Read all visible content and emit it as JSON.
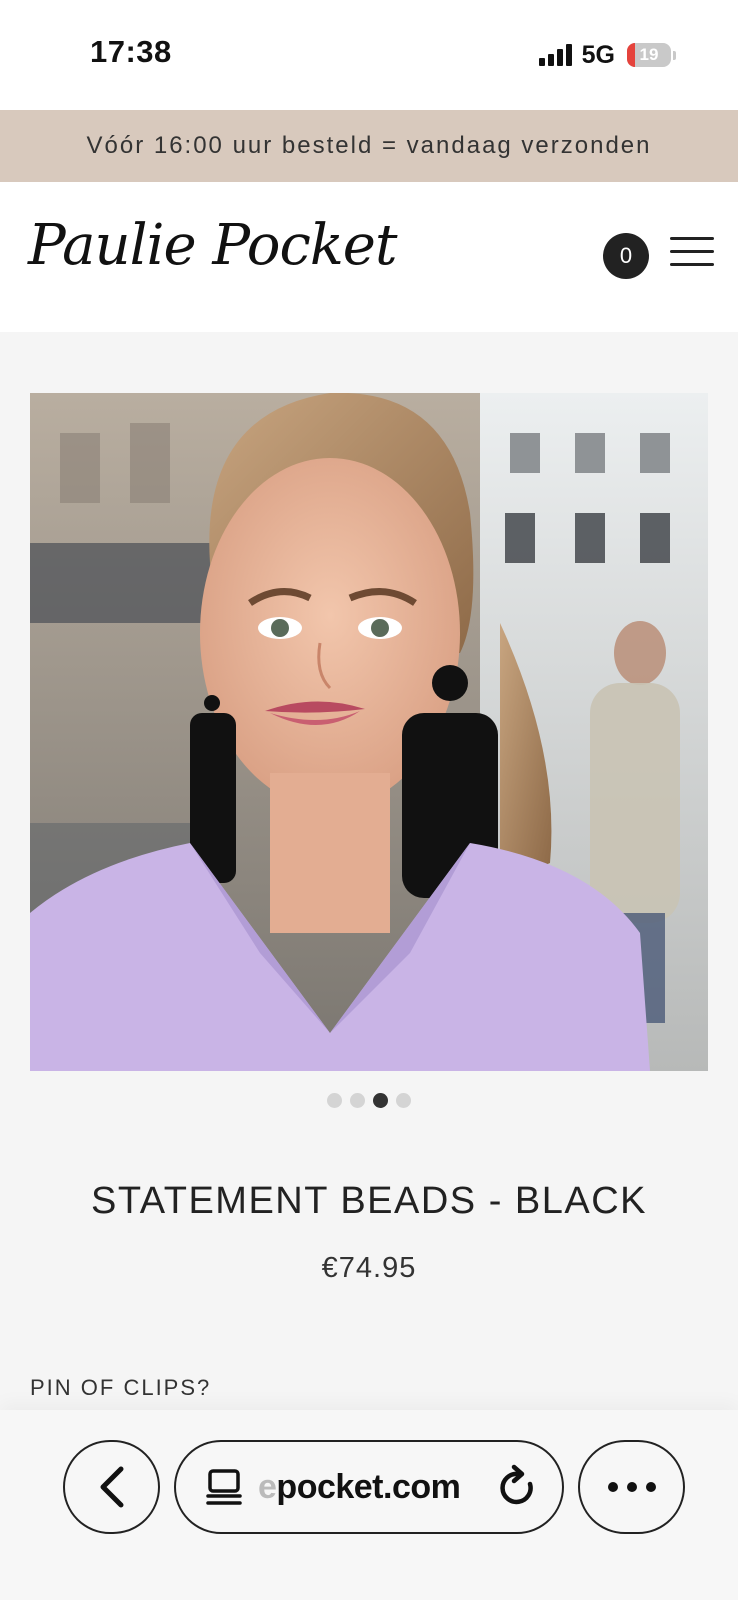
{
  "status_bar": {
    "time": "17:38",
    "network": "5G",
    "battery_percent": "19",
    "battery_level": 0.19
  },
  "promo_banner": {
    "text": "Vóór 16:00 uur besteld = vandaag verzonden"
  },
  "header": {
    "logo_text": "Paulie Pocket",
    "cart_count": "0",
    "menu_icon": "hamburger-menu-icon"
  },
  "gallery": {
    "total_images": 4,
    "active_index": 2
  },
  "product": {
    "title": "STATEMENT BEADS - BLACK",
    "price": "€74.95",
    "option_label": "PIN OF CLIPS?"
  },
  "browser": {
    "url_prefix_faded": "e",
    "url_text": "pocket.com",
    "back_icon": "chevron-left-icon",
    "tabs_icon": "tabs-icon",
    "reload_icon": "reload-icon",
    "more_icon": "more-dots-icon"
  },
  "colors": {
    "promo_bg": "#d8c9bd",
    "page_bg": "#f5f5f5",
    "accent_dark": "#222222",
    "battery_red": "#e5433c"
  }
}
